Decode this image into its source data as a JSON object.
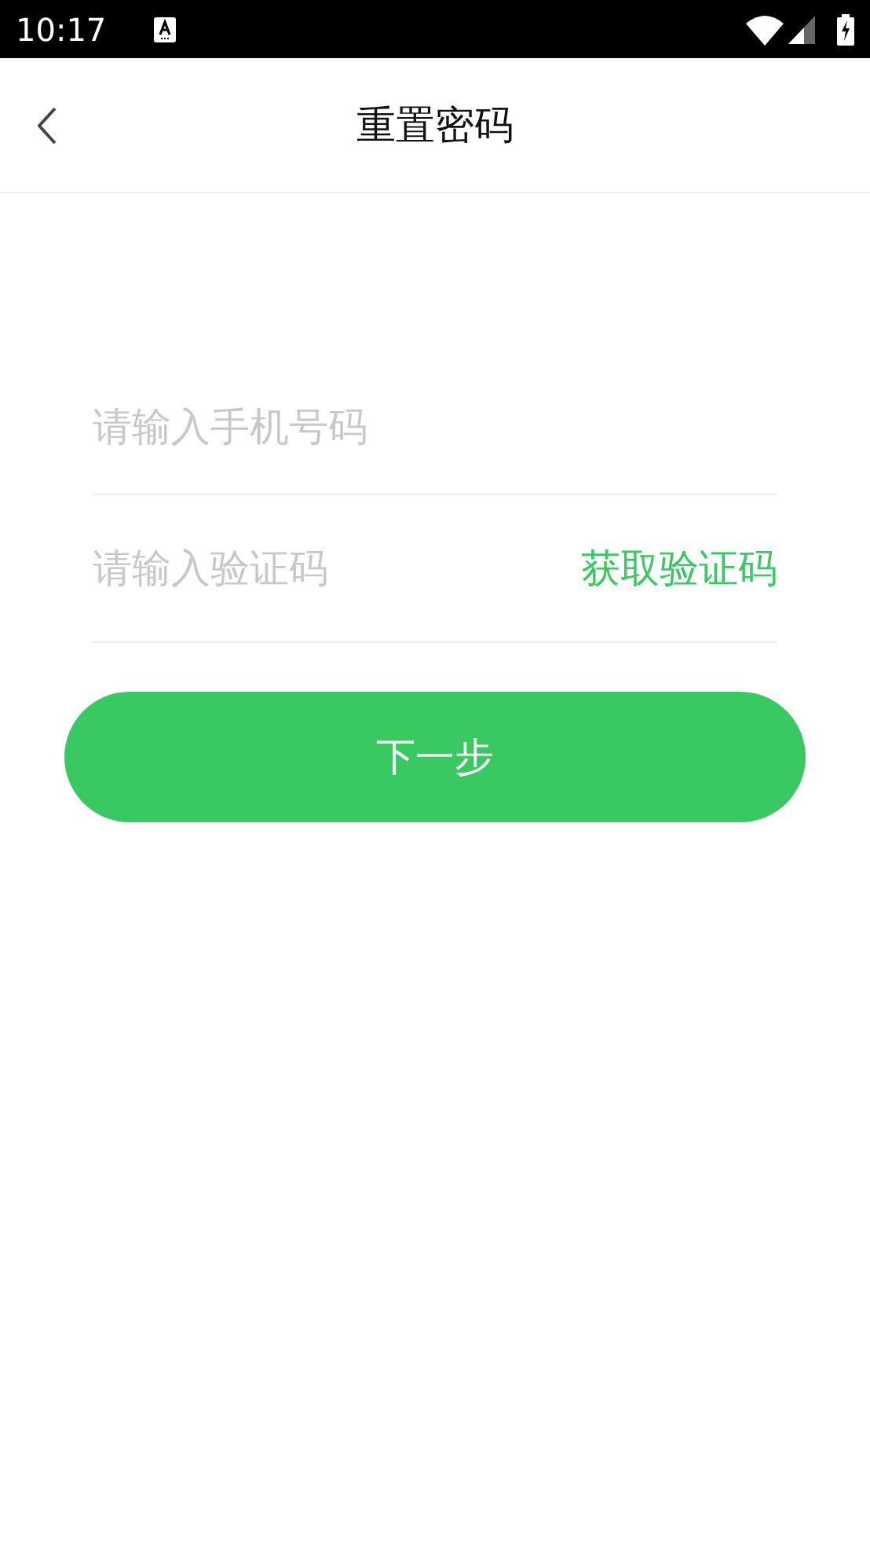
{
  "status_bar": {
    "time": "10:17"
  },
  "header": {
    "title": "重置密码"
  },
  "form": {
    "phone": {
      "placeholder": "请输入手机号码"
    },
    "code": {
      "placeholder": "请输入验证码"
    },
    "get_code": "获取验证码",
    "next": "下一步"
  }
}
